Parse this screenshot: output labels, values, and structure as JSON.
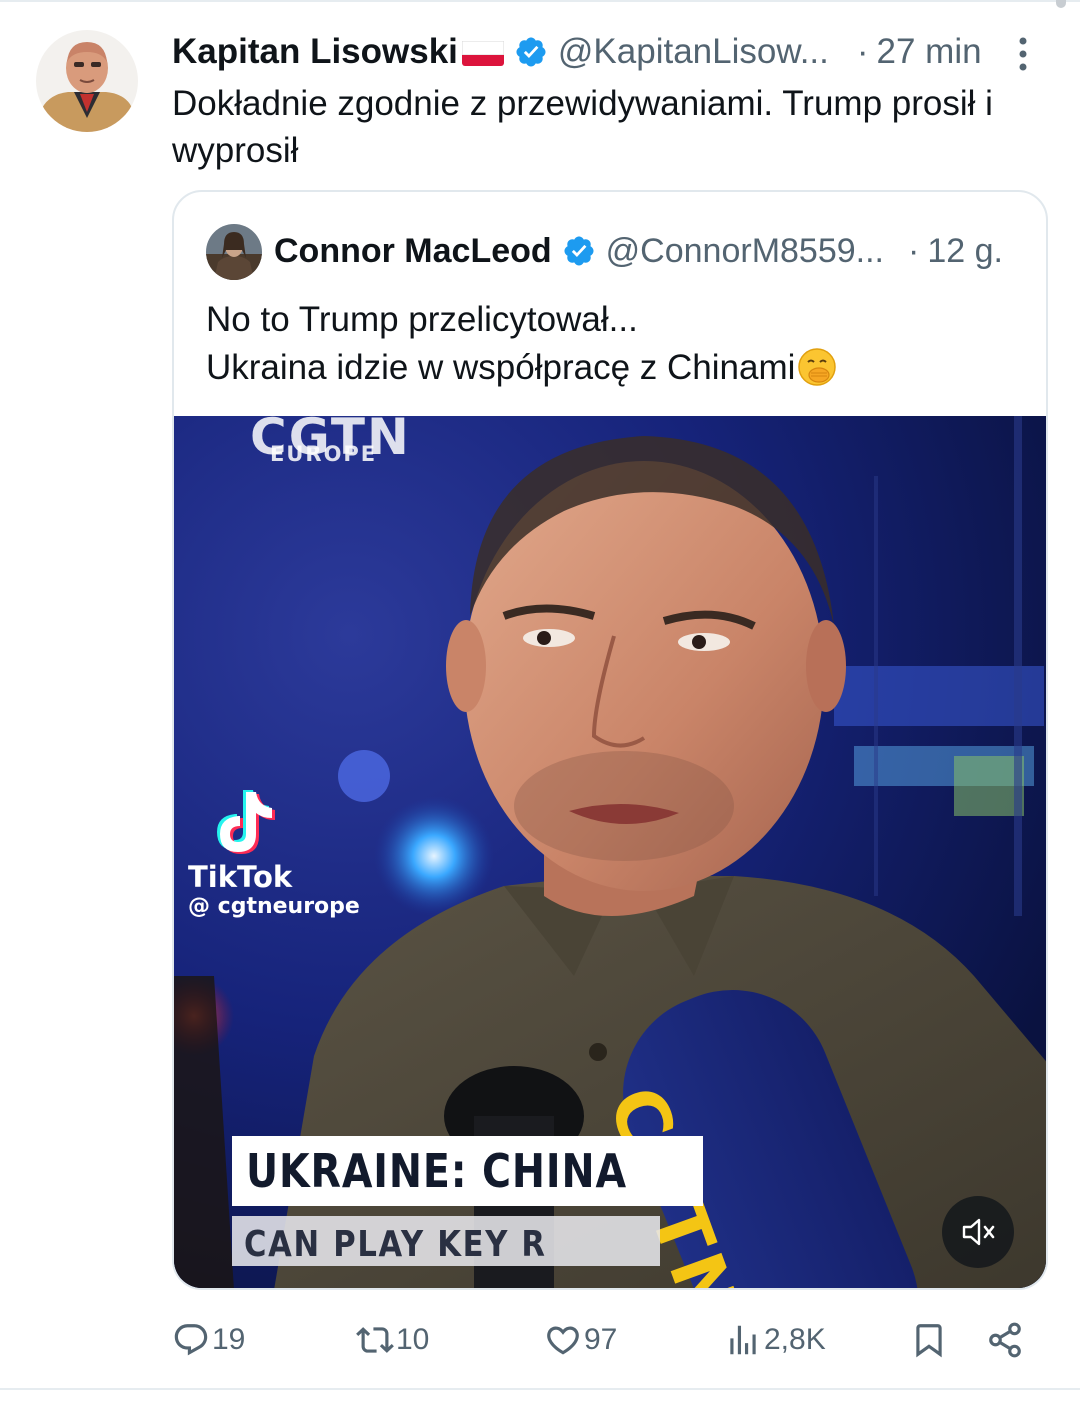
{
  "tweet": {
    "author_name": "Kapitan Lisowski",
    "author_handle": "@KapitanLisow...",
    "separator": "·",
    "time": "27 min",
    "text": "Dokładnie zgodnie z przewidywaniami. Trump prosił i wyprosił"
  },
  "quote": {
    "author_name": "Connor MacLeod",
    "author_handle": "@ConnorM8559...",
    "separator": "·",
    "time": "12 g.",
    "text_line1": "No to Trump przelicytował...",
    "text_line2": "Ukraina idzie w współpracę z Chinami",
    "emoji": "🤭"
  },
  "video": {
    "logo_text": "CGTN",
    "logo_subtext": "EUROPE",
    "watermark_label": "TikTok",
    "watermark_handle": "@ cgtneurope",
    "chyron_headline": "UKRAINE: CHINA",
    "chyron_subline": "CAN PLAY KEY R",
    "mic_text": "CGTN",
    "mute_icon": "speaker-muted-icon"
  },
  "actions": {
    "replies": "19",
    "reposts": "10",
    "likes": "97",
    "views": "2,8K"
  },
  "colors": {
    "verified_blue": "#1d9bf0",
    "muted_text": "#536471",
    "mic_yellow": "#f4c514"
  }
}
